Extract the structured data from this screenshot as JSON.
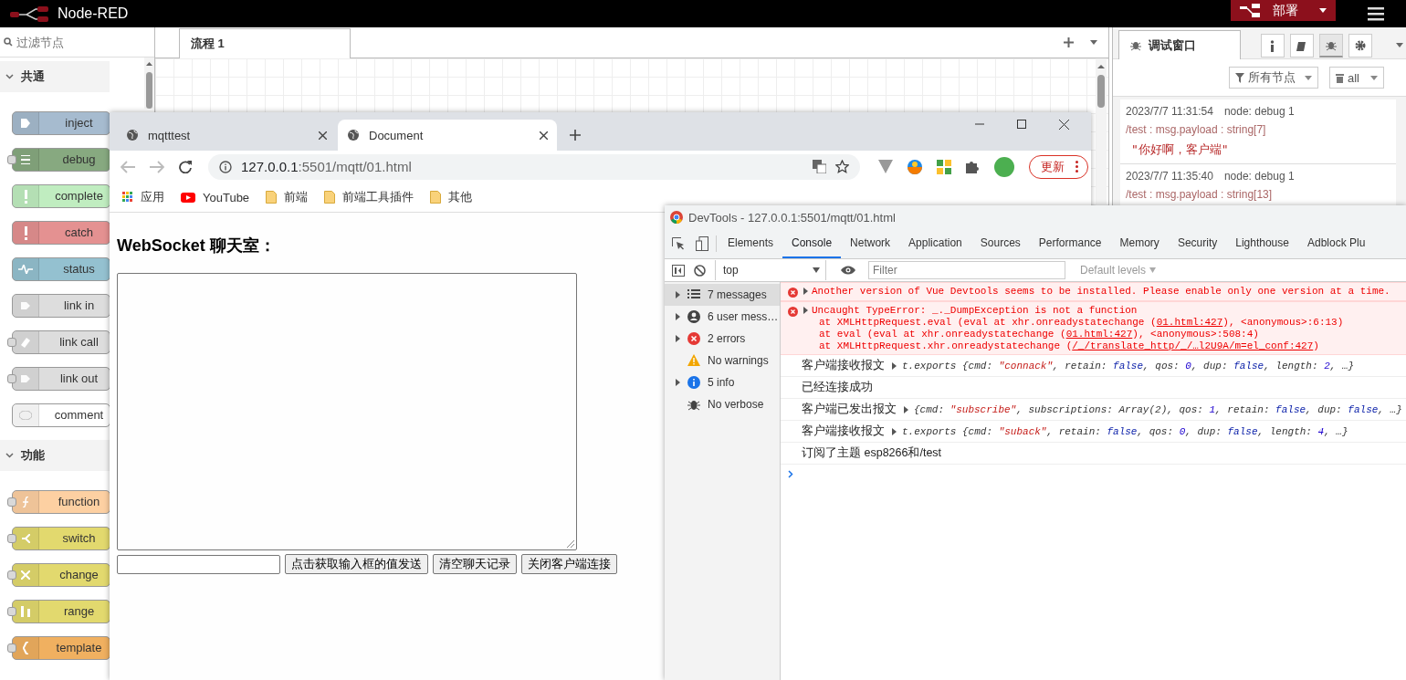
{
  "header": {
    "title": "Node-RED",
    "deploy": "部署"
  },
  "palette": {
    "filter_placeholder": "过滤节点",
    "categories": [
      {
        "label": "共通",
        "expanded": true,
        "nodes": [
          {
            "label": "inject",
            "color": "#a6bbcf",
            "input": false
          },
          {
            "label": "debug",
            "color": "#87a980",
            "input": true
          },
          {
            "label": "complete",
            "color": "#c0edc0",
            "input": false
          },
          {
            "label": "catch",
            "color": "#e49191",
            "input": false
          },
          {
            "label": "status",
            "color": "#94c1d0",
            "input": false
          },
          {
            "label": "link in",
            "color": "#dddddd",
            "input": false
          },
          {
            "label": "link call",
            "color": "#dddddd",
            "input": true
          },
          {
            "label": "link out",
            "color": "#dddddd",
            "input": true
          },
          {
            "label": "comment",
            "color": "#ffffff",
            "input": false
          }
        ]
      },
      {
        "label": "功能",
        "expanded": true,
        "nodes": [
          {
            "label": "function",
            "color": "#fdd0a2",
            "input": true
          },
          {
            "label": "switch",
            "color": "#e2d96e",
            "input": true
          },
          {
            "label": "change",
            "color": "#e2d96e",
            "input": true
          },
          {
            "label": "range",
            "color": "#e2d96e",
            "input": true
          },
          {
            "label": "template",
            "color": "#f0b060",
            "input": true
          }
        ]
      }
    ]
  },
  "workspace": {
    "tabs": [
      {
        "label": "流程 1",
        "selected": true
      }
    ]
  },
  "sidebar": {
    "tabs": [
      {
        "label": "调试窗口",
        "selected": true
      }
    ],
    "filter": "所有节点",
    "clear": "all",
    "messages": [
      {
        "time": "2023/7/7 11:31:54",
        "node": "node: debug 1",
        "topic": "/test : msg.payload : string[7]",
        "payload": "\"你好啊，客户端\""
      },
      {
        "time": "2023/7/7 11:35:40",
        "node": "node: debug 1",
        "topic": "/test : msg.payload : string[13]"
      }
    ]
  },
  "browser": {
    "tabs": [
      {
        "label": "mqtttest",
        "selected": false
      },
      {
        "label": "Document",
        "selected": true
      }
    ],
    "url_host": "127.0.0.1",
    "url_rest": ":5501/mqtt/01.html",
    "update": "更新",
    "bookmarks": [
      {
        "label": "应用",
        "kind": "apps"
      },
      {
        "label": "YouTube",
        "kind": "youtube"
      },
      {
        "label": "前端",
        "kind": "folder"
      },
      {
        "label": "前端工具插件",
        "kind": "folder"
      },
      {
        "label": "其他",
        "kind": "folder"
      }
    ],
    "page": {
      "heading": "WebSocket 聊天室：",
      "buttons": [
        "点击获取输入框的值发送",
        "清空聊天记录",
        "关闭客户端连接"
      ]
    }
  },
  "devtools": {
    "title": "DevTools - 127.0.0.1:5501/mqtt/01.html",
    "tabs": [
      {
        "label": "Elements",
        "selected": false
      },
      {
        "label": "Console",
        "selected": true
      },
      {
        "label": "Network",
        "selected": false
      },
      {
        "label": "Application",
        "selected": false
      },
      {
        "label": "Sources",
        "selected": false
      },
      {
        "label": "Performance",
        "selected": false
      },
      {
        "label": "Memory",
        "selected": false
      },
      {
        "label": "Security",
        "selected": false
      },
      {
        "label": "Lighthouse",
        "selected": false
      },
      {
        "label": "Adblock Plu",
        "selected": false
      }
    ],
    "context": "top",
    "filter_placeholder": "Filter",
    "levels": "Default levels",
    "sidebar": [
      {
        "label": "7 messages",
        "kind": "list",
        "expandable": true,
        "selected": true
      },
      {
        "label": "6 user mess…",
        "kind": "user",
        "expandable": true,
        "selected": false
      },
      {
        "label": "2 errors",
        "kind": "error",
        "expandable": true,
        "selected": false
      },
      {
        "label": "No warnings",
        "kind": "warning",
        "expandable": false,
        "selected": false
      },
      {
        "label": "5 info",
        "kind": "info",
        "expandable": true,
        "selected": false
      },
      {
        "label": "No verbose",
        "kind": "verbose",
        "expandable": false,
        "selected": false
      }
    ],
    "messages": [
      {
        "kind": "error",
        "text": "Another version of Vue Devtools seems to be installed. Please enable only one version at a time."
      },
      {
        "kind": "error",
        "text": "Uncaught TypeError: _._DumpException is not a function",
        "stack": [
          {
            "before": "at XMLHttpRequest.eval (eval at xhr.onreadystatechange (",
            "link": "01.html:427",
            "after": "), <anonymous>:6:13)"
          },
          {
            "before": "at eval (eval at xhr.onreadystatechange (",
            "link": "01.html:427",
            "after": "), <anonymous>:508:4)"
          },
          {
            "before": "at XMLHttpRequest.xhr.onreadystatechange (",
            "link": "/_/translate_http/_/…l2U9A/m=el_conf:427",
            "after": ")"
          }
        ]
      },
      {
        "kind": "log",
        "label": "客户端接收报文",
        "expandable": true,
        "parts": [
          {
            "text": "t.exports {cmd: ",
            "kind": "plain"
          },
          {
            "text": "\"connack\"",
            "kind": "string"
          },
          {
            "text": ", retain: ",
            "kind": "plain"
          },
          {
            "text": "false",
            "kind": "keyword"
          },
          {
            "text": ", qos: ",
            "kind": "plain"
          },
          {
            "text": "0",
            "kind": "number"
          },
          {
            "text": ", dup: ",
            "kind": "plain"
          },
          {
            "text": "false",
            "kind": "keyword"
          },
          {
            "text": ", length: ",
            "kind": "plain"
          },
          {
            "text": "2",
            "kind": "number"
          },
          {
            "text": ", …}",
            "kind": "plain"
          }
        ]
      },
      {
        "kind": "log",
        "label": "已经连接成功",
        "expandable": false
      },
      {
        "kind": "log",
        "label": "客户端已发出报文",
        "expandable": true,
        "parts": [
          {
            "text": "{cmd: ",
            "kind": "plain"
          },
          {
            "text": "\"subscribe\"",
            "kind": "string"
          },
          {
            "text": ", subscriptions: Array(2), qos: ",
            "kind": "plain"
          },
          {
            "text": "1",
            "kind": "number"
          },
          {
            "text": ", retain: ",
            "kind": "plain"
          },
          {
            "text": "false",
            "kind": "keyword"
          },
          {
            "text": ", dup: ",
            "kind": "plain"
          },
          {
            "text": "false",
            "kind": "keyword"
          },
          {
            "text": ", …}",
            "kind": "plain"
          }
        ]
      },
      {
        "kind": "log",
        "label": "客户端接收报文",
        "expandable": true,
        "parts": [
          {
            "text": "t.exports {cmd: ",
            "kind": "plain"
          },
          {
            "text": "\"suback\"",
            "kind": "string"
          },
          {
            "text": ", retain: ",
            "kind": "plain"
          },
          {
            "text": "false",
            "kind": "keyword"
          },
          {
            "text": ", qos: ",
            "kind": "plain"
          },
          {
            "text": "0",
            "kind": "number"
          },
          {
            "text": ", dup: ",
            "kind": "plain"
          },
          {
            "text": "false",
            "kind": "keyword"
          },
          {
            "text": ", length: ",
            "kind": "plain"
          },
          {
            "text": "4",
            "kind": "number"
          },
          {
            "text": ", …}",
            "kind": "plain"
          }
        ]
      },
      {
        "kind": "log",
        "label": "订阅了主题 esp8266和/test",
        "expandable": false
      },
      {
        "kind": "prompt"
      }
    ]
  }
}
